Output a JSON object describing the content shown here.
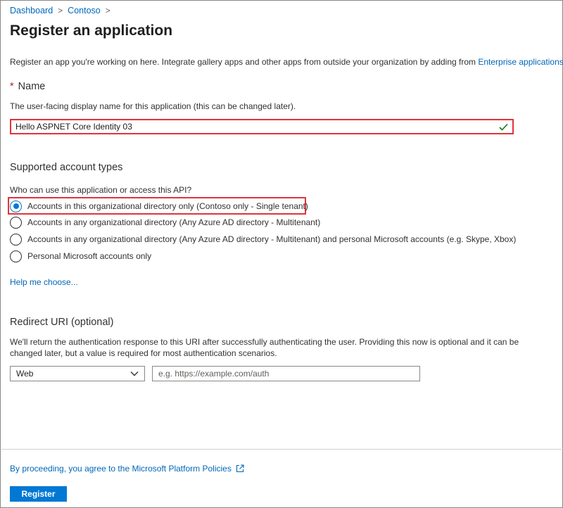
{
  "breadcrumb": {
    "items": [
      "Dashboard",
      "Contoso"
    ],
    "separator": ">"
  },
  "page": {
    "title": "Register an application"
  },
  "intro": {
    "text": "Register an app you're working on here. Integrate gallery apps and other apps from outside your organization by adding from ",
    "link": "Enterprise applications",
    "end": "."
  },
  "name_section": {
    "required_mark": "*",
    "label": "Name",
    "help": "The user-facing display name for this application (this can be changed later).",
    "value": "Hello ASPNET Core Identity 03",
    "valid_icon": "check-icon"
  },
  "account_types": {
    "label": "Supported account types",
    "question": "Who can use this application or access this API?",
    "options": [
      {
        "label": "Accounts in this organizational directory only (Contoso only - Single tenant)",
        "selected": true
      },
      {
        "label": "Accounts in any organizational directory (Any Azure AD directory - Multitenant)",
        "selected": false
      },
      {
        "label": "Accounts in any organizational directory (Any Azure AD directory - Multitenant) and personal Microsoft accounts (e.g. Skype, Xbox)",
        "selected": false
      },
      {
        "label": "Personal Microsoft accounts only",
        "selected": false
      }
    ],
    "help_link": "Help me choose..."
  },
  "redirect": {
    "label": "Redirect URI (optional)",
    "description": "We'll return the authentication response to this URI after successfully authenticating the user. Providing this now is optional and it can be changed later, but a value is required for most authentication scenarios.",
    "platform_value": "Web",
    "uri_placeholder": "e.g. https://example.com/auth"
  },
  "footer": {
    "policy_text": "By proceeding, you agree to the Microsoft Platform Policies",
    "register_label": "Register"
  },
  "colors": {
    "accent": "#0078d4",
    "link": "#0067b8",
    "highlight": "#e0343b",
    "valid": "#107c10"
  }
}
